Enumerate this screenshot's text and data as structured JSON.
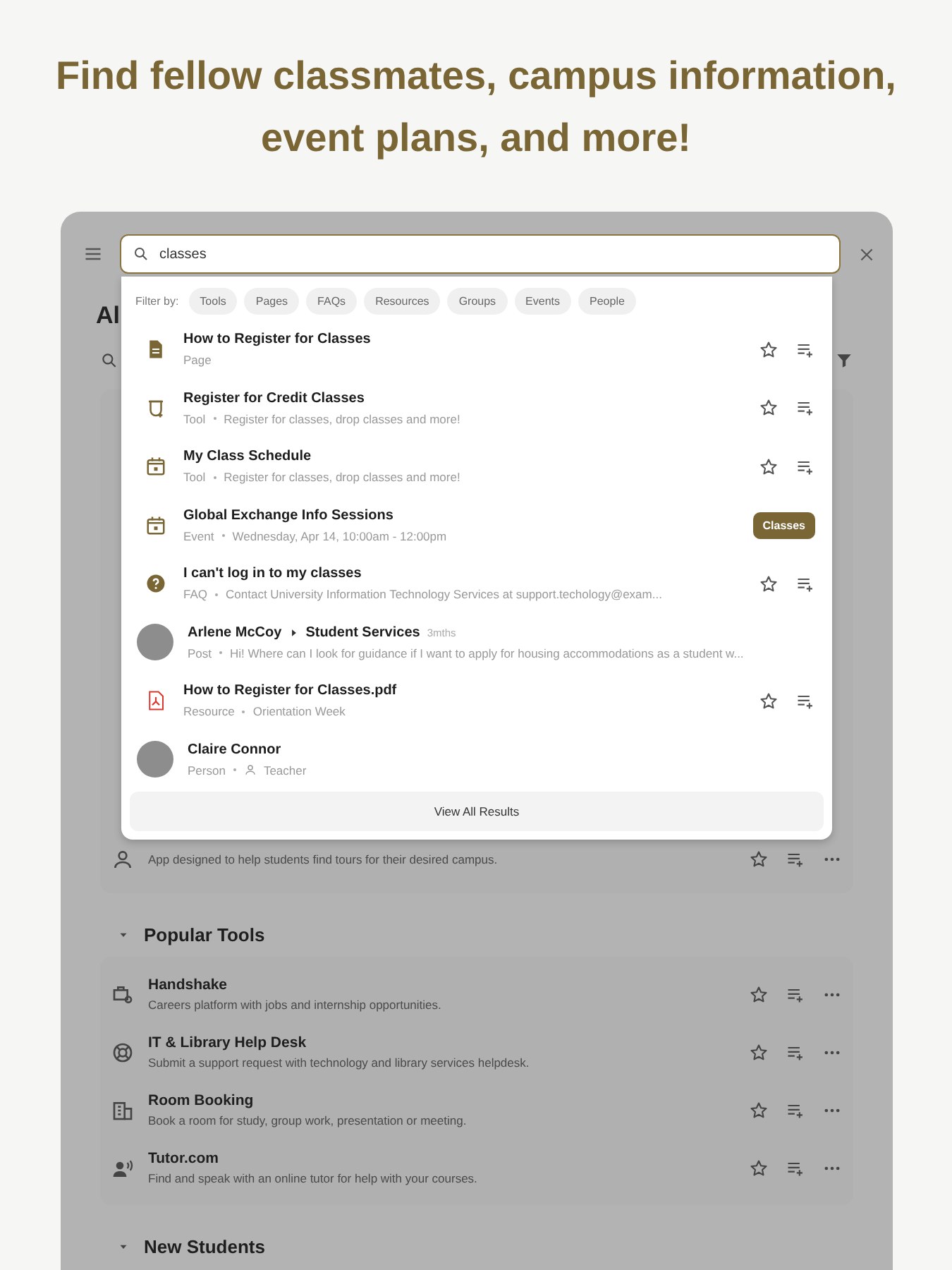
{
  "headline": "Find fellow classmates, campus information, event plans, and more!",
  "search": {
    "value": "classes"
  },
  "filters": {
    "label": "Filter by:",
    "chips": [
      {
        "label": "Tools",
        "selected": false
      },
      {
        "label": "Pages",
        "selected": false
      },
      {
        "label": "FAQs",
        "selected": false
      },
      {
        "label": "Resources",
        "selected": false
      },
      {
        "label": "Groups",
        "selected": false
      },
      {
        "label": "Events",
        "selected": false
      },
      {
        "label": "People",
        "selected": false
      }
    ]
  },
  "results": [
    {
      "kind": "page",
      "title": "How to Register for Classes",
      "type": "Page"
    },
    {
      "kind": "tool",
      "title": "Register for Credit Classes",
      "type": "Tool",
      "detail": "Register for classes, drop classes and more!"
    },
    {
      "kind": "schedule",
      "title": "My Class Schedule",
      "type": "Tool",
      "detail": "Register for classes, drop classes and more!"
    },
    {
      "kind": "event",
      "title": "Global Exchange Info Sessions",
      "type": "Event",
      "detail": "Wednesday, Apr 14, 10:00am - 12:00pm",
      "tag": "Classes"
    },
    {
      "kind": "faq",
      "title": "I can't log in to my classes",
      "type": "FAQ",
      "detail": "Contact University Information Technology Services at support.techology@exam..."
    },
    {
      "kind": "post",
      "title": "Arlene McCoy",
      "target": "Student Services",
      "age": "3mths",
      "type": "Post",
      "detail": "Hi! Where can I look for guidance if I want to apply for housing accommodations as a student w..."
    },
    {
      "kind": "resource",
      "title": "How to Register for Classes.pdf",
      "type": "Resource",
      "detail": "Orientation Week"
    },
    {
      "kind": "person",
      "title": "Claire Connor",
      "type": "Person",
      "role": "Teacher"
    }
  ],
  "view_all": "View All Results",
  "page_heading": "Al",
  "sections": [
    {
      "rows": [
        {
          "kind": "tours",
          "description": "App designed to help students find tours for their desired campus."
        }
      ]
    },
    {
      "title": "Popular Tools",
      "expanded": true,
      "rows": [
        {
          "kind": "careers",
          "title": "Handshake",
          "description": "Careers platform with jobs and internship opportunities."
        },
        {
          "kind": "helpdesk",
          "title": "IT & Library Help Desk",
          "description": "Submit a support request with technology and library services helpdesk."
        },
        {
          "kind": "booking",
          "title": "Room Booking",
          "description": "Book a room for study, group work, presentation or meeting."
        },
        {
          "kind": "tutoring",
          "title": "Tutor.com",
          "description": "Find and speak with an online tutor for help with your courses."
        }
      ]
    },
    {
      "title": "New Students",
      "expanded": true
    }
  ]
}
